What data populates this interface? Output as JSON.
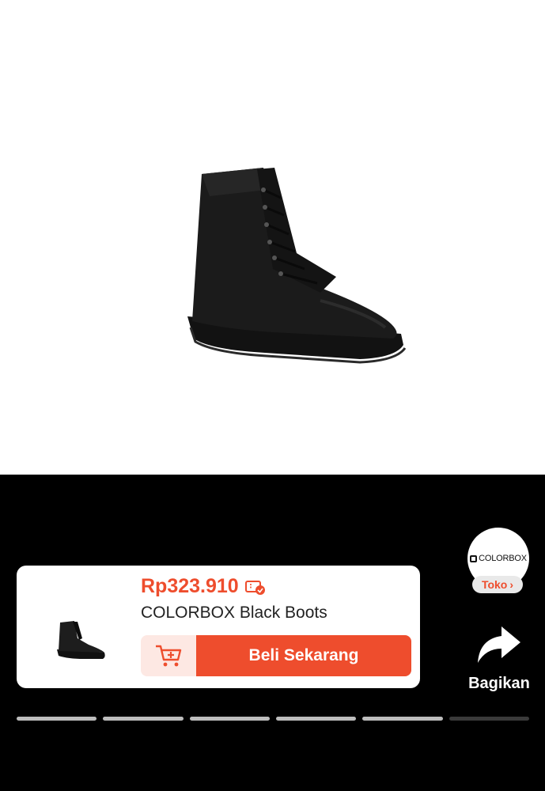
{
  "product": {
    "price": "Rp323.910",
    "title": "COLORBOX Black Boots",
    "image_icon": "boot-image"
  },
  "actions": {
    "buy_label": "Beli Sekarang",
    "cart_icon": "add-to-cart-icon",
    "share_label": "Bagikan"
  },
  "shop": {
    "logo_text": "COLORBOX",
    "toko_label": "Toko",
    "toko_chevron": "›"
  },
  "progress": {
    "total_segments": 6,
    "active_segments": 5
  },
  "colors": {
    "accent": "#ee4d2d",
    "cart_bg": "#fde8e3",
    "background": "#000000"
  }
}
